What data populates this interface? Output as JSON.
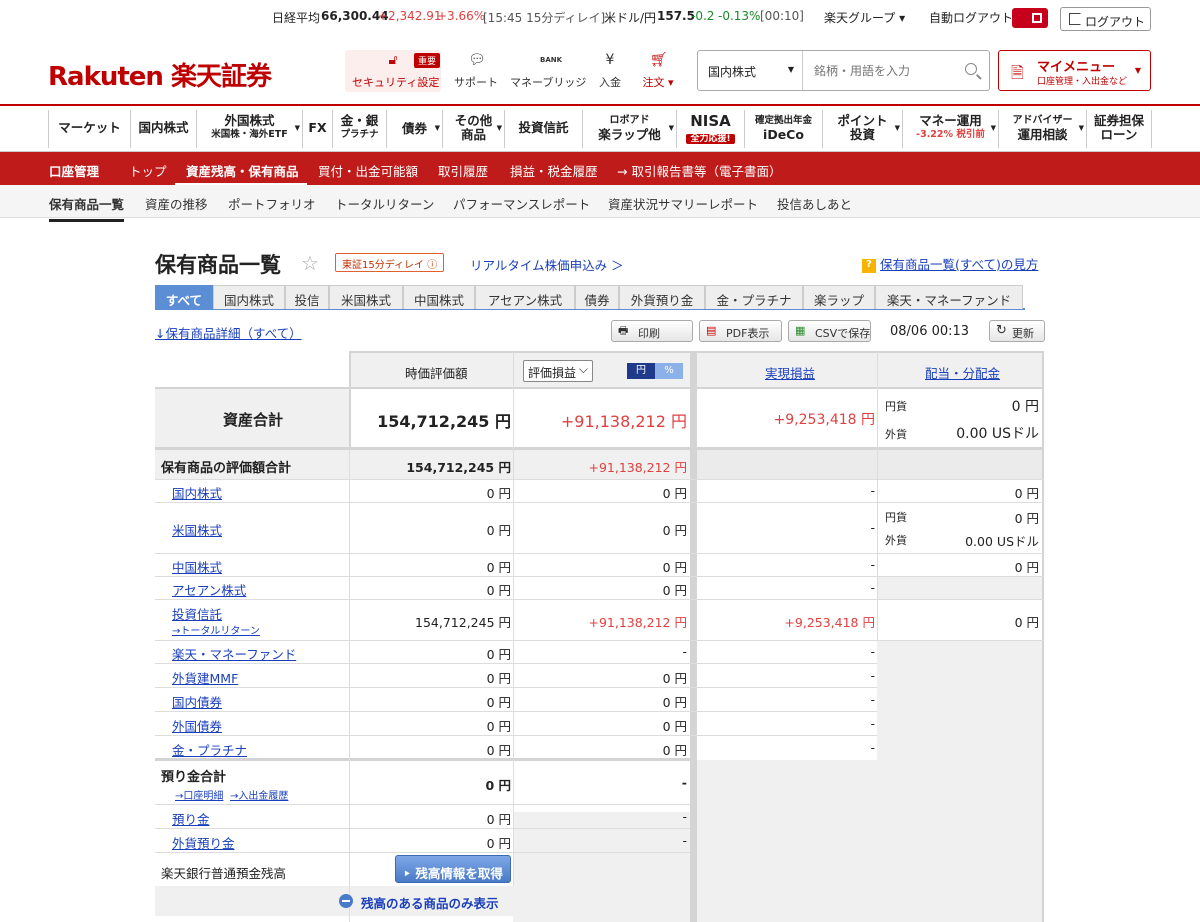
{
  "ticker": {
    "nikkei_label": "日経平均",
    "nikkei_value": "66,300.44",
    "nikkei_change": "+2,342.91",
    "nikkei_pct": "+3.66%",
    "nikkei_time": "[15:45 15分ディレイ]",
    "usd_label": "米ドル/円",
    "usd_value": "157.5",
    "usd_change": "-0.2",
    "usd_pct": "-0.13%",
    "usd_time": "[00:10]",
    "group_label": "楽天グループ ▾",
    "auto_logout": "自動ログアウト",
    "logout": "ログアウト"
  },
  "header": {
    "logo": "Rakuten 楽天証券",
    "security_label": "セキュリティ設定",
    "security_badge": "重要",
    "support": "サポート",
    "money_bridge": "マネーブリッジ",
    "bank_text": "BANK",
    "deposit": "入金",
    "order": "注文 ▾",
    "search_category": "国内株式",
    "search_placeholder": "銘柄・用語を入力",
    "mymenu_title": "マイメニュー",
    "mymenu_sub": "口座管理・入出金など"
  },
  "nav": [
    {
      "l1": "マーケット",
      "l2": ""
    },
    {
      "l1": "国内株式",
      "l2": ""
    },
    {
      "l1": "外国株式",
      "l2": "米国株・海外ETF"
    },
    {
      "l1": "FX",
      "l2": ""
    },
    {
      "l1": "金・銀",
      "l2": "プラチナ"
    },
    {
      "l1": "債券",
      "l2": ""
    },
    {
      "l1": "その他",
      "l2": "商品"
    },
    {
      "l1": "投資信託",
      "l2": ""
    },
    {
      "l1": "ロボアド",
      "l2": "楽ラップ他"
    },
    {
      "l1": "NISA",
      "l2": "全力応援!"
    },
    {
      "l1": "確定拠出年金",
      "l2": "iDeCo"
    },
    {
      "l1": "ポイント",
      "l2": "投資"
    },
    {
      "l1": "マネー運用",
      "l2": "-3.22% 税引前"
    },
    {
      "l1": "アドバイザー",
      "l2": "運用相談"
    },
    {
      "l1": "証券担保",
      "l2": "ローン"
    }
  ],
  "account_bar": [
    "口座管理",
    "トップ",
    "資産残高・保有商品",
    "買付・出金可能額",
    "取引履歴",
    "損益・税金履歴",
    "→ 取引報告書等（電子書面）"
  ],
  "sub_nav": [
    "保有商品一覧",
    "資産の推移",
    "ポートフォリオ",
    "トータルリターン",
    "パフォーマンスレポート",
    "資産状況サマリーレポート",
    "投信あしあと"
  ],
  "page": {
    "title": "保有商品一覧",
    "delay_badge": "東証15分ディレイ",
    "realtime_link": "リアルタイム株価申込み ＞",
    "howto": "保有商品一覧(すべて)の見方"
  },
  "tabs": [
    "すべて",
    "国内株式",
    "投信",
    "米国株式",
    "中国株式",
    "アセアン株式",
    "債券",
    "外貨預り金",
    "金・プラチナ",
    "楽ラップ",
    "楽天・マネーファンド"
  ],
  "toolbar": {
    "detail_link": "↓保有商品詳細（すべて）",
    "print": "印刷",
    "pdf": "PDF表示",
    "csv": "CSVで保存",
    "timestamp": "08/06 00:13",
    "refresh": "更新"
  },
  "table": {
    "h_value": "時価評価額",
    "h_select": "評価損益",
    "h_yen": "円",
    "h_pct": "%",
    "h_realized": "実現損益",
    "h_dividend": "配当・分配金",
    "total_label": "資産合計",
    "total_value": "154,712,245 円",
    "total_pl": "+91,138,212 円",
    "total_realized": "+9,253,418 円",
    "total_div_jpy_label": "円貨",
    "total_div_jpy": "0 円",
    "total_div_fx_label": "外貨",
    "total_div_fx": "0.00 USドル",
    "holdings_label": "保有商品の評価額合計",
    "holdings_value": "154,712,245 円",
    "holdings_pl": "+91,138,212 円",
    "rows": [
      {
        "label": "国内株式",
        "value": "0 円",
        "pl": "0 円",
        "realized": "-",
        "div": "0 円"
      },
      {
        "label": "米国株式",
        "value": "0 円",
        "pl": "0 円",
        "realized": "-",
        "div_jpy_label": "円貨",
        "div_jpy": "0 円",
        "div_fx_label": "外貨",
        "div_fx": "0.00 USドル"
      },
      {
        "label": "中国株式",
        "value": "0 円",
        "pl": "0 円",
        "realized": "-",
        "div": "0 円"
      },
      {
        "label": "アセアン株式",
        "value": "0 円",
        "pl": "0 円",
        "realized": "-"
      },
      {
        "label": "投資信託",
        "sublink": "→トータルリターン",
        "value": "154,712,245 円",
        "pl": "+91,138,212 円",
        "realized": "+9,253,418 円",
        "div": "0 円"
      },
      {
        "label": "楽天・マネーファンド",
        "value": "0 円",
        "pl": "-",
        "realized": "-"
      },
      {
        "label": "外貨建MMF",
        "value": "0 円",
        "pl": "0 円",
        "realized": "-"
      },
      {
        "label": "国内債券",
        "value": "0 円",
        "pl": "0 円",
        "realized": "-"
      },
      {
        "label": "外国債券",
        "value": "0 円",
        "pl": "0 円",
        "realized": "-"
      },
      {
        "label": "金・プラチナ",
        "value": "0 円",
        "pl": "0 円",
        "realized": "-"
      }
    ],
    "deposit_total_label": "預り金合計",
    "deposit_link1": "→口座明細",
    "deposit_link2": "→入出金履歴",
    "deposit_total_value": "0 円",
    "deposit_total_pl": "-",
    "deposit_label": "預り金",
    "deposit_value": "0 円",
    "deposit_pl": "-",
    "fx_deposit_label": "外貨預り金",
    "fx_deposit_value": "0 円",
    "fx_deposit_pl": "-",
    "bank_label": "楽天銀行普通預金残高",
    "bank_button": "残高情報を取得",
    "only_balance": "残高のある商品のみ表示"
  }
}
